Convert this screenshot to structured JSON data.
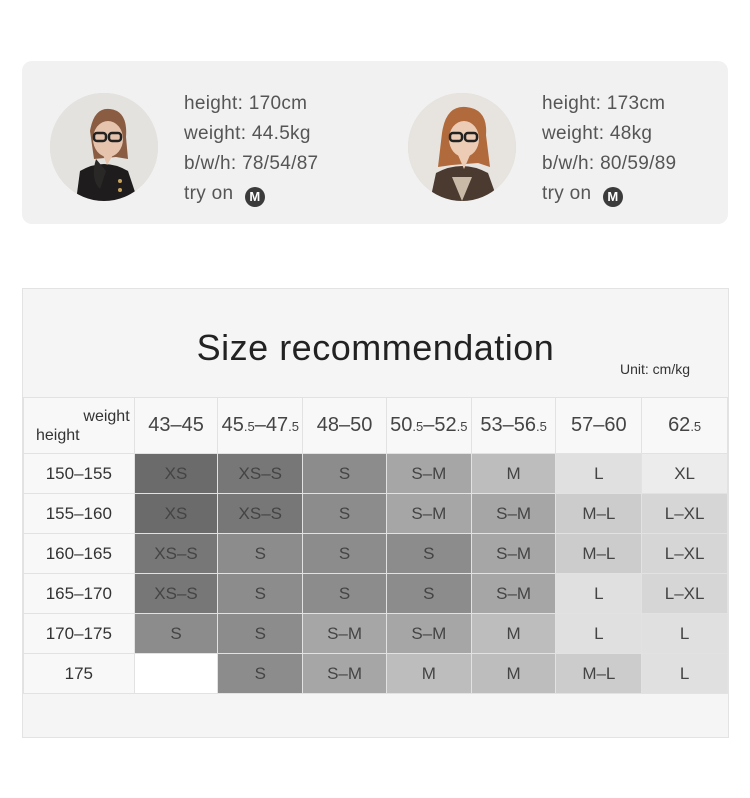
{
  "models": [
    {
      "height": "height:  170cm",
      "weight": "weight:  44.5kg",
      "bwh": "b/w/h:  78/54/87",
      "try_on": "try on",
      "size": "M"
    },
    {
      "height": "height:  173cm",
      "weight": "weight:  48kg",
      "bwh": "b/w/h:  80/59/89",
      "try_on": "try on",
      "size": "M"
    }
  ],
  "size_table": {
    "title": "Size recommendation",
    "unit": "Unit: cm/kg",
    "corner_weight": "weight",
    "corner_height": "height",
    "columns": [
      {
        "main": "43–45",
        "parts": []
      },
      {
        "parts": [
          "45",
          ".5",
          "–47",
          ".5"
        ]
      },
      {
        "main": "48–50",
        "parts": []
      },
      {
        "parts": [
          "50",
          ".5",
          "–52",
          ".5"
        ]
      },
      {
        "parts": [
          "53–56",
          ".5"
        ]
      },
      {
        "main": "57–60",
        "parts": []
      },
      {
        "parts": [
          "62",
          ".5"
        ]
      }
    ],
    "rows": [
      {
        "height": "150–155",
        "cells": [
          "XS",
          "XS–S",
          "S",
          "S–M",
          "M",
          "L",
          "XL"
        ]
      },
      {
        "height": "155–160",
        "cells": [
          "XS",
          "XS–S",
          "S",
          "S–M",
          "S–M",
          "M–L",
          "L–XL"
        ]
      },
      {
        "height": "160–165",
        "cells": [
          "XS–S",
          "S",
          "S",
          "S",
          "S–M",
          "M–L",
          "L–XL"
        ]
      },
      {
        "height": "165–170",
        "cells": [
          "XS–S",
          "S",
          "S",
          "S",
          "S–M",
          "L",
          "L–XL"
        ]
      },
      {
        "height": "170–175",
        "cells": [
          "S",
          "S",
          "S–M",
          "S–M",
          "M",
          "L",
          "L"
        ]
      },
      {
        "height": "175",
        "cells": [
          "",
          "S",
          "S–M",
          "M",
          "M",
          "M–L",
          "L"
        ]
      }
    ],
    "size_colors": {
      "XS": "#6b6b6b",
      "XS–S": "#777777",
      "S": "#8c8c8c",
      "S–M": "#a6a6a6",
      "M": "#bdbdbd",
      "M–L": "#cccccc",
      "L": "#e0e0e0",
      "L–XL": "#d6d6d6",
      "XL": "#ececec",
      "": "#ffffff"
    }
  }
}
